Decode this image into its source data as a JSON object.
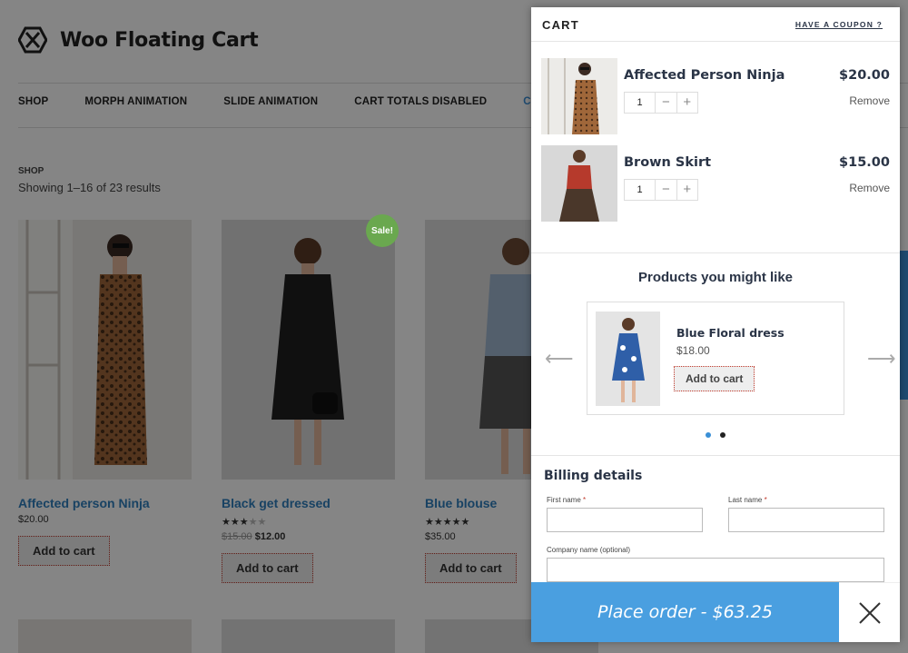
{
  "site": {
    "title": "Woo Floating Cart",
    "nav": [
      "SHOP",
      "MORPH ANIMATION",
      "SLIDE ANIMATION",
      "CART TOTALS DISABLED",
      "CHECK"
    ],
    "breadcrumb": "SHOP",
    "results": "Showing 1–16 of 23 results",
    "products": [
      {
        "name": "Affected person Ninja",
        "price": "$20.00",
        "button": "Add to cart"
      },
      {
        "name": "Black get dressed",
        "old_price": "$15.00",
        "price": "$12.00",
        "rating": 3,
        "badge": "Sale!",
        "button": "Add to cart"
      },
      {
        "name": "Blue blouse",
        "price": "$35.00",
        "rating": 5,
        "button": "Add to cart"
      }
    ]
  },
  "cart": {
    "title": "CART",
    "coupon": "HAVE A COUPON ?",
    "items": [
      {
        "name": "Affected Person Ninja",
        "price": "$20.00",
        "qty": "1",
        "remove": "Remove"
      },
      {
        "name": "Brown Skirt",
        "price": "$15.00",
        "qty": "1",
        "remove": "Remove"
      }
    ],
    "recommend": {
      "title": "Products you might like",
      "product": {
        "name": "Blue Floral dress",
        "price": "$18.00",
        "button": "Add to cart"
      },
      "prev_icon": "arrow-left-icon",
      "next_icon": "arrow-right-icon",
      "active_dot": 0
    },
    "billing": {
      "title": "Billing details",
      "first_name": "First name",
      "last_name": "Last name",
      "company": "Company name (optional)"
    },
    "place_order": "Place order - $63.25"
  },
  "colors": {
    "accent": "#4a9fe0",
    "link": "#2f7fbf",
    "sale": "#6aa84f"
  }
}
